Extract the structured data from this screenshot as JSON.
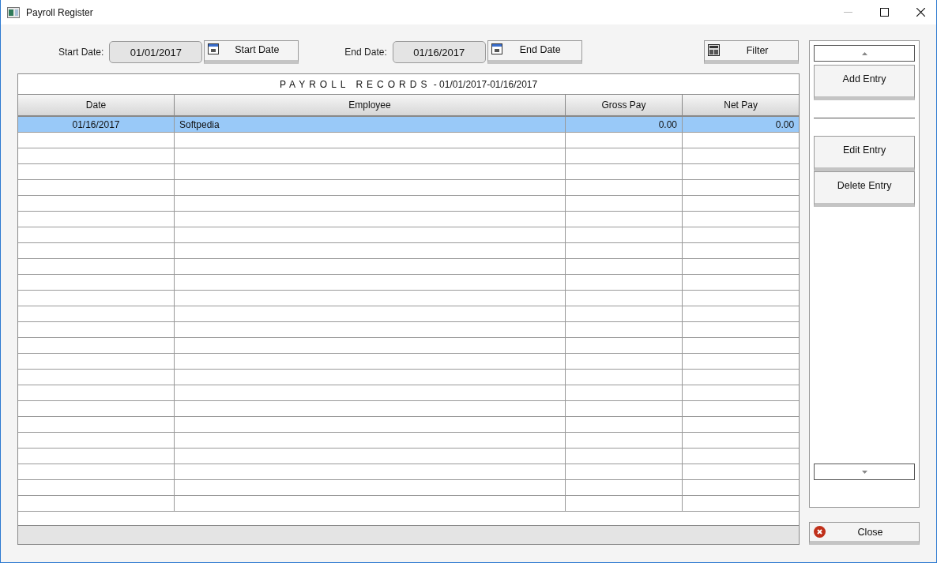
{
  "window": {
    "title": "Payroll Register"
  },
  "filters": [
    {
      "label": "Start Date:",
      "value": "01/01/2017",
      "button": "Start Date"
    },
    {
      "label": "End Date:",
      "value": "01/16/2017",
      "button": "End Date"
    }
  ],
  "filter_button": "Filter",
  "table": {
    "title": "PAYROLL RECORDS",
    "range": "- 01/01/2017-01/16/2017",
    "columns": [
      "Date",
      "Employee",
      "Gross Pay",
      "Net Pay"
    ],
    "rows": [
      {
        "cells": [
          "01/16/2017",
          "Softpedia",
          "0.00",
          "0.00"
        ],
        "selected": true
      }
    ]
  },
  "side_buttons": {
    "top": [
      "Add Entry"
    ],
    "bottom": [
      "Edit Entry",
      "Delete Entry"
    ]
  },
  "close_button": "Close"
}
